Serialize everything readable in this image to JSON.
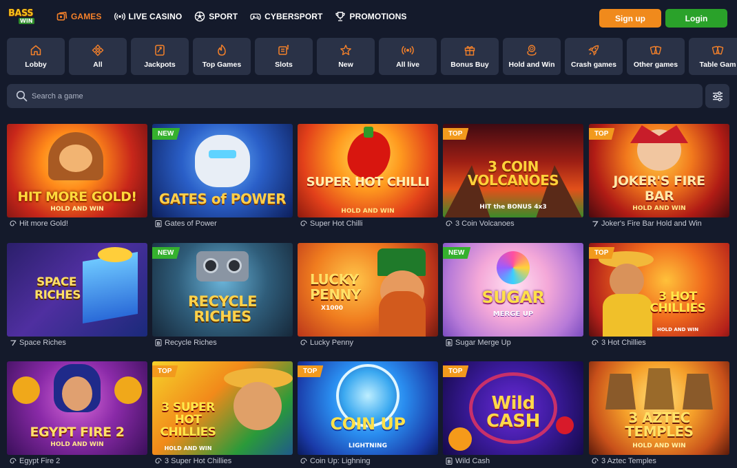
{
  "brand": {
    "logo_top": "BASS",
    "logo_bottom": "WIN"
  },
  "nav": [
    {
      "label": "GAMES",
      "icon": "games-icon",
      "active": true
    },
    {
      "label": "LIVE CASINO",
      "icon": "live-broadcast-icon",
      "active": false
    },
    {
      "label": "SPORT",
      "icon": "soccer-ball-icon",
      "active": false
    },
    {
      "label": "CYBERSPORT",
      "icon": "gamepad-icon",
      "active": false
    },
    {
      "label": "PROMOTIONS",
      "icon": "trophy-icon",
      "active": false
    }
  ],
  "auth": {
    "signup_label": "Sign up",
    "login_label": "Login"
  },
  "categories": [
    {
      "label": "Lobby",
      "icon": "home-icon"
    },
    {
      "label": "All",
      "icon": "diamond-grid-icon"
    },
    {
      "label": "Jackpots",
      "icon": "jackpot-icon"
    },
    {
      "label": "Top Games",
      "icon": "flame-icon"
    },
    {
      "label": "Slots",
      "icon": "slot-machine-icon"
    },
    {
      "label": "New",
      "icon": "star-icon"
    },
    {
      "label": "All live",
      "icon": "live-broadcast-icon"
    },
    {
      "label": "Bonus Buy",
      "icon": "gift-icon"
    },
    {
      "label": "Hold and Win",
      "icon": "coins-icon"
    },
    {
      "label": "Crash games",
      "icon": "rocket-icon"
    },
    {
      "label": "Other games",
      "icon": "cards-icon"
    },
    {
      "label": "Table Gam",
      "icon": "cards-icon"
    }
  ],
  "search": {
    "placeholder": "Search a game"
  },
  "games": [
    {
      "title": "Hit more Gold!",
      "badge": "",
      "provider_icon": "spiral-icon",
      "art": [
        "HIT MORE GOLD!",
        "HOLD AND WIN"
      ]
    },
    {
      "title": "Gates of Power",
      "badge": "NEW",
      "provider_icon": "b-icon",
      "art": [
        "GATES of POWER",
        ""
      ]
    },
    {
      "title": "Super Hot Chilli",
      "badge": "",
      "provider_icon": "spiral-icon",
      "art": [
        "SUPER HOT CHILLI",
        "HOLD AND WIN"
      ]
    },
    {
      "title": "3 Coin Volcanoes",
      "badge": "TOP",
      "provider_icon": "spiral-icon",
      "art": [
        "3 COIN VOLCANOES",
        "HIT the BONUS 4x3"
      ]
    },
    {
      "title": "Joker's Fire Bar Hold and Win",
      "badge": "TOP",
      "provider_icon": "seven-icon",
      "art": [
        "JOKER'S FIRE BAR",
        "HOLD AND WIN"
      ]
    },
    {
      "title": "Space Riches",
      "badge": "",
      "provider_icon": "seven-icon",
      "art": [
        "SPACE RICHES",
        ""
      ]
    },
    {
      "title": "Recycle Riches",
      "badge": "NEW",
      "provider_icon": "b-icon",
      "art": [
        "RECYCLE RICHES",
        ""
      ]
    },
    {
      "title": "Lucky Penny",
      "badge": "",
      "provider_icon": "spiral-icon",
      "art": [
        "LUCKY PENNY",
        "X1000"
      ]
    },
    {
      "title": "Sugar Merge Up",
      "badge": "NEW",
      "provider_icon": "b-icon",
      "art": [
        "SUGAR",
        "MERGE UP"
      ]
    },
    {
      "title": "3 Hot Chillies",
      "badge": "TOP",
      "provider_icon": "spiral-icon",
      "art": [
        "3 HOT CHILLIES",
        "HOLD AND WIN"
      ]
    },
    {
      "title": "Egypt Fire 2",
      "badge": "",
      "provider_icon": "spiral-icon",
      "art": [
        "EGYPT FIRE 2",
        "HOLD AND WIN"
      ]
    },
    {
      "title": "3 Super Hot Chillies",
      "badge": "TOP",
      "provider_icon": "spiral-icon",
      "art": [
        "3 SUPER HOT CHILLIES",
        "HOLD AND WIN"
      ]
    },
    {
      "title": "Coin Up: Lighning",
      "badge": "TOP",
      "provider_icon": "spiral-icon",
      "art": [
        "COIN UP",
        "LIGHTNING"
      ]
    },
    {
      "title": "Wild Cash",
      "badge": "TOP",
      "provider_icon": "b-icon",
      "art": [
        "Wild CASH",
        ""
      ]
    },
    {
      "title": "3 Aztec Temples",
      "badge": "",
      "provider_icon": "spiral-icon",
      "art": [
        "3 AZTEC TEMPLES",
        "HOLD AND WIN"
      ]
    }
  ],
  "colors": {
    "accent": "#f5812a",
    "signup": "#f08a1c",
    "login": "#2aa22a",
    "background": "#141a2b",
    "panel": "#2a3247"
  }
}
